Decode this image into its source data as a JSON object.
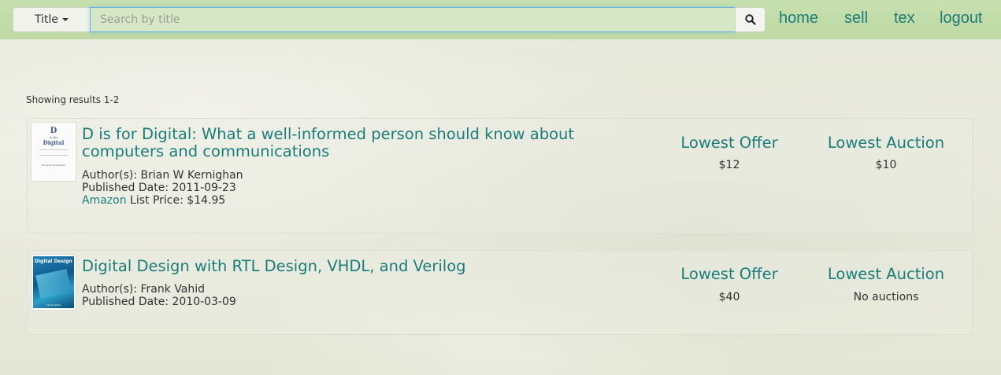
{
  "navbar": {
    "category_label": "Title",
    "search_placeholder": "Search by title",
    "search_value": "",
    "links": [
      "home",
      "sell",
      "tex",
      "logout"
    ]
  },
  "results": {
    "summary": "Showing results 1-2",
    "column_headers": {
      "offer": "Lowest Offer",
      "auction": "Lowest Auction"
    },
    "items": [
      {
        "title": "D is for Digital: What a well-informed person should know about computers and communications",
        "authors": "Author(s): Brian W Kernighan",
        "published": "Published Date: 2011-09-23",
        "list_price_link": "Amazon",
        "list_price_text": " List Price: $14.95",
        "cover_lines": [
          "D",
          "is for",
          "Digital",
          "Brian W. Kernighan"
        ],
        "lowest_offer": "$12",
        "lowest_auction": "$10"
      },
      {
        "title": "Digital Design with RTL Design, VHDL, and Verilog",
        "authors": "Author(s): Frank Vahid",
        "published": "Published Date: 2010-03-09",
        "cover_lines": [
          "Digital Design",
          "Frank Vahid"
        ],
        "lowest_offer": "$40",
        "lowest_auction": "No auctions"
      }
    ]
  },
  "colors": {
    "navbar_bg": "#c3dcaa",
    "link": "#1a7d7a",
    "focus_border": "#66afe9"
  }
}
